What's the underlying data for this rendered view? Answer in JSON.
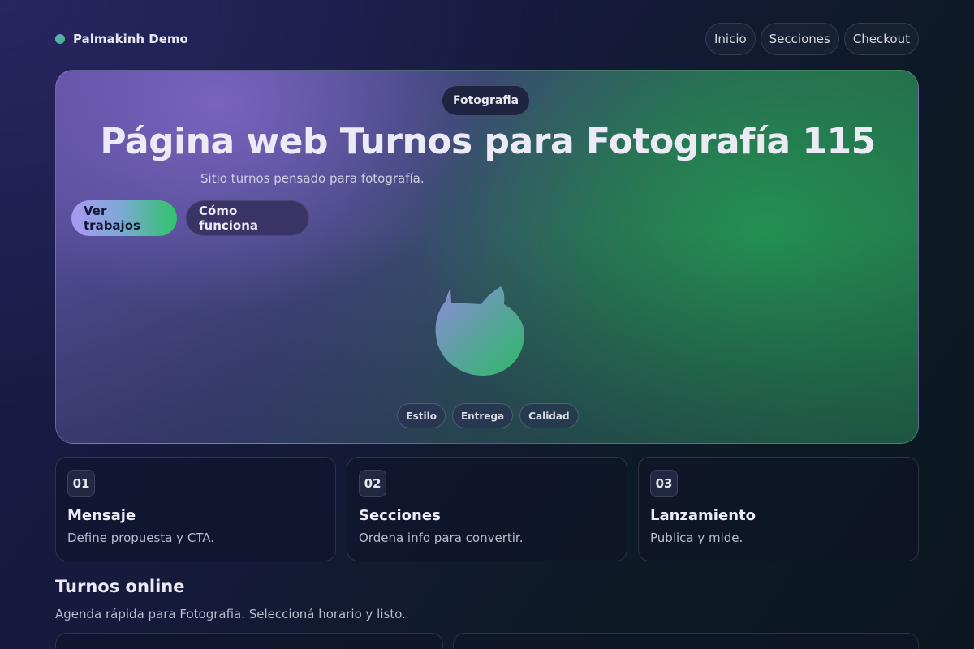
{
  "nav": {
    "brand": "Palmakinh Demo",
    "links": [
      "Inicio",
      "Secciones",
      "Checkout"
    ]
  },
  "hero": {
    "tag": "Fotografia",
    "title": "Página web Turnos para Fotografía 115",
    "subtitle": "Sitio turnos pensado para fotografía.",
    "primary_cta": "Ver trabajos",
    "secondary_cta": "Cómo funciona",
    "illustration_icon": "camera-blob-icon",
    "chips": [
      "Estilo",
      "Entrega",
      "Calidad"
    ]
  },
  "steps": [
    {
      "num": "01",
      "title": "Mensaje",
      "desc": "Define propuesta y CTA."
    },
    {
      "num": "02",
      "title": "Secciones",
      "desc": "Ordena info para convertir."
    },
    {
      "num": "03",
      "title": "Lanzamiento",
      "desc": "Publica y mide."
    }
  ],
  "turnos": {
    "title": "Turnos online",
    "subtitle": "Agenda rápida para Fotografia. Seleccioná horario y listo."
  },
  "colors": {
    "accent_purple": "#a89af2",
    "accent_green": "#2fc46a",
    "background": "#151a3a"
  }
}
